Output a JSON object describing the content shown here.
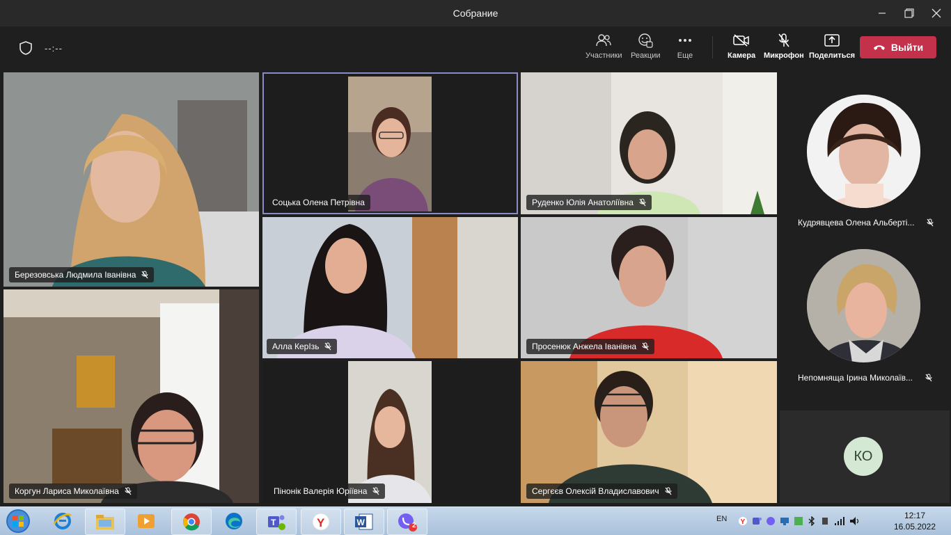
{
  "window": {
    "title": "Собрание"
  },
  "toolbar": {
    "timer": "--:--",
    "participants": "Участники",
    "reactions": "Реакции",
    "more": "Еще",
    "camera": "Камера",
    "microphone": "Микрофон",
    "share": "Поделиться",
    "leave": "Выйти"
  },
  "tiles": [
    {
      "name": "Березовська Людмила Іванівна",
      "muted": true
    },
    {
      "name": "Соцька Олена Петрівна",
      "muted": false,
      "active": true
    },
    {
      "name": "Руденко Юлія Анатоліївна",
      "muted": true
    },
    {
      "name": "Алла КерІзь",
      "muted": true
    },
    {
      "name": "Просенюк Анжела Іванівна",
      "muted": true
    },
    {
      "name": "Коргун Лариса Миколаївна",
      "muted": true
    },
    {
      "name": "Пінонік Валерія Юріївна",
      "muted": true
    },
    {
      "name": "Сергєєв Олексій Владиславович",
      "muted": true
    }
  ],
  "side_participants": [
    {
      "name": "Кудрявцева Олена Альберті...",
      "muted": true
    },
    {
      "name": "Непомняща Ірина Миколаїв...",
      "muted": true
    },
    {
      "initials": "КО"
    }
  ],
  "taskbar": {
    "viber_badge": "2",
    "lang": "EN",
    "time": "12:17",
    "date": "16.05.2022"
  },
  "colors": {
    "leave": "#c4314b",
    "active_outline": "#8b8cc7",
    "avatar_ko": "#d5e8d4"
  },
  "icons": [
    "shield-icon",
    "participants-icon",
    "reactions-icon",
    "more-icon",
    "camera-off-icon",
    "mic-off-icon",
    "share-icon",
    "phone-hangup-icon",
    "minimize-icon",
    "maximize-icon",
    "close-icon"
  ]
}
